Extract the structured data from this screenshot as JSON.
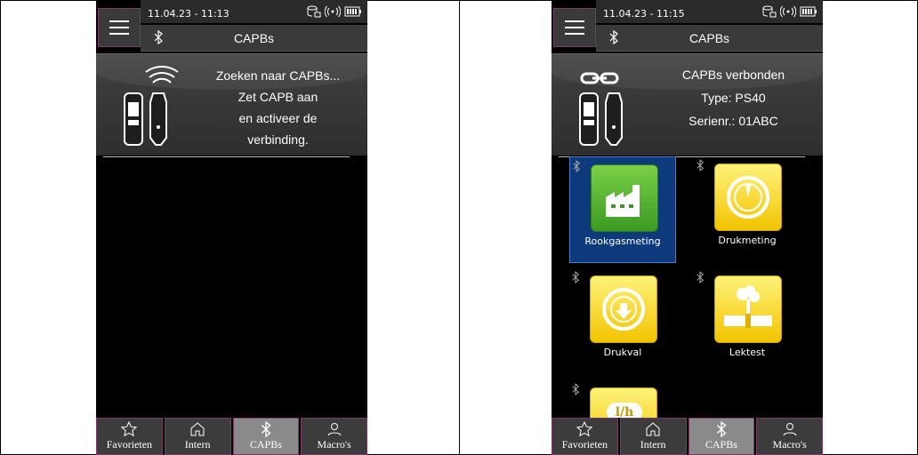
{
  "left": {
    "statusbar": {
      "time": "11.04.23 - 11:13"
    },
    "titlebar": {
      "title": "CAPBs"
    },
    "info_lines": [
      "Zoeken naar CAPBs...",
      "Zet CAPB aan",
      "en activeer de",
      "verbinding."
    ]
  },
  "right": {
    "statusbar": {
      "time": "11.04.23 - 11:15"
    },
    "titlebar": {
      "title": "CAPBs"
    },
    "info_lines": [
      "CAPBs verbonden",
      "Type: PS40",
      "Serienr.: 01ABC"
    ],
    "tiles": [
      {
        "label": "Rookgasmeting",
        "color": "#4aa52e"
      },
      {
        "label": "Drukmeting",
        "color": "#f5d000"
      },
      {
        "label": "Drukval",
        "color": "#f5d000"
      },
      {
        "label": "Lektest",
        "color": "#f5d000"
      },
      {
        "label": "",
        "badge": "l/h",
        "color": "#f5d000"
      }
    ]
  },
  "tabs": [
    {
      "label": "Favorieten",
      "icon": "star-icon"
    },
    {
      "label": "Intern",
      "icon": "home-icon"
    },
    {
      "label": "CAPBs",
      "icon": "bluetooth-icon"
    },
    {
      "label": "Macro's",
      "icon": "user-icon"
    }
  ],
  "colors": {
    "accent_border": "#7a3a6a",
    "selected_tile": "#0d3a7a",
    "active_tab": "#8a8a8a"
  }
}
